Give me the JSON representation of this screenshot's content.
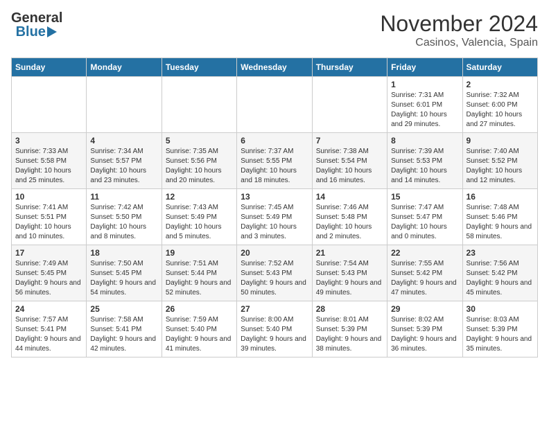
{
  "header": {
    "logo_general": "General",
    "logo_blue": "Blue",
    "title": "November 2024",
    "subtitle": "Casinos, Valencia, Spain"
  },
  "weekdays": [
    "Sunday",
    "Monday",
    "Tuesday",
    "Wednesday",
    "Thursday",
    "Friday",
    "Saturday"
  ],
  "weeks": [
    [
      {
        "day": "",
        "info": ""
      },
      {
        "day": "",
        "info": ""
      },
      {
        "day": "",
        "info": ""
      },
      {
        "day": "",
        "info": ""
      },
      {
        "day": "",
        "info": ""
      },
      {
        "day": "1",
        "info": "Sunrise: 7:31 AM\nSunset: 6:01 PM\nDaylight: 10 hours and 29 minutes."
      },
      {
        "day": "2",
        "info": "Sunrise: 7:32 AM\nSunset: 6:00 PM\nDaylight: 10 hours and 27 minutes."
      }
    ],
    [
      {
        "day": "3",
        "info": "Sunrise: 7:33 AM\nSunset: 5:58 PM\nDaylight: 10 hours and 25 minutes."
      },
      {
        "day": "4",
        "info": "Sunrise: 7:34 AM\nSunset: 5:57 PM\nDaylight: 10 hours and 23 minutes."
      },
      {
        "day": "5",
        "info": "Sunrise: 7:35 AM\nSunset: 5:56 PM\nDaylight: 10 hours and 20 minutes."
      },
      {
        "day": "6",
        "info": "Sunrise: 7:37 AM\nSunset: 5:55 PM\nDaylight: 10 hours and 18 minutes."
      },
      {
        "day": "7",
        "info": "Sunrise: 7:38 AM\nSunset: 5:54 PM\nDaylight: 10 hours and 16 minutes."
      },
      {
        "day": "8",
        "info": "Sunrise: 7:39 AM\nSunset: 5:53 PM\nDaylight: 10 hours and 14 minutes."
      },
      {
        "day": "9",
        "info": "Sunrise: 7:40 AM\nSunset: 5:52 PM\nDaylight: 10 hours and 12 minutes."
      }
    ],
    [
      {
        "day": "10",
        "info": "Sunrise: 7:41 AM\nSunset: 5:51 PM\nDaylight: 10 hours and 10 minutes."
      },
      {
        "day": "11",
        "info": "Sunrise: 7:42 AM\nSunset: 5:50 PM\nDaylight: 10 hours and 8 minutes."
      },
      {
        "day": "12",
        "info": "Sunrise: 7:43 AM\nSunset: 5:49 PM\nDaylight: 10 hours and 5 minutes."
      },
      {
        "day": "13",
        "info": "Sunrise: 7:45 AM\nSunset: 5:49 PM\nDaylight: 10 hours and 3 minutes."
      },
      {
        "day": "14",
        "info": "Sunrise: 7:46 AM\nSunset: 5:48 PM\nDaylight: 10 hours and 2 minutes."
      },
      {
        "day": "15",
        "info": "Sunrise: 7:47 AM\nSunset: 5:47 PM\nDaylight: 10 hours and 0 minutes."
      },
      {
        "day": "16",
        "info": "Sunrise: 7:48 AM\nSunset: 5:46 PM\nDaylight: 9 hours and 58 minutes."
      }
    ],
    [
      {
        "day": "17",
        "info": "Sunrise: 7:49 AM\nSunset: 5:45 PM\nDaylight: 9 hours and 56 minutes."
      },
      {
        "day": "18",
        "info": "Sunrise: 7:50 AM\nSunset: 5:45 PM\nDaylight: 9 hours and 54 minutes."
      },
      {
        "day": "19",
        "info": "Sunrise: 7:51 AM\nSunset: 5:44 PM\nDaylight: 9 hours and 52 minutes."
      },
      {
        "day": "20",
        "info": "Sunrise: 7:52 AM\nSunset: 5:43 PM\nDaylight: 9 hours and 50 minutes."
      },
      {
        "day": "21",
        "info": "Sunrise: 7:54 AM\nSunset: 5:43 PM\nDaylight: 9 hours and 49 minutes."
      },
      {
        "day": "22",
        "info": "Sunrise: 7:55 AM\nSunset: 5:42 PM\nDaylight: 9 hours and 47 minutes."
      },
      {
        "day": "23",
        "info": "Sunrise: 7:56 AM\nSunset: 5:42 PM\nDaylight: 9 hours and 45 minutes."
      }
    ],
    [
      {
        "day": "24",
        "info": "Sunrise: 7:57 AM\nSunset: 5:41 PM\nDaylight: 9 hours and 44 minutes."
      },
      {
        "day": "25",
        "info": "Sunrise: 7:58 AM\nSunset: 5:41 PM\nDaylight: 9 hours and 42 minutes."
      },
      {
        "day": "26",
        "info": "Sunrise: 7:59 AM\nSunset: 5:40 PM\nDaylight: 9 hours and 41 minutes."
      },
      {
        "day": "27",
        "info": "Sunrise: 8:00 AM\nSunset: 5:40 PM\nDaylight: 9 hours and 39 minutes."
      },
      {
        "day": "28",
        "info": "Sunrise: 8:01 AM\nSunset: 5:39 PM\nDaylight: 9 hours and 38 minutes."
      },
      {
        "day": "29",
        "info": "Sunrise: 8:02 AM\nSunset: 5:39 PM\nDaylight: 9 hours and 36 minutes."
      },
      {
        "day": "30",
        "info": "Sunrise: 8:03 AM\nSunset: 5:39 PM\nDaylight: 9 hours and 35 minutes."
      }
    ]
  ]
}
